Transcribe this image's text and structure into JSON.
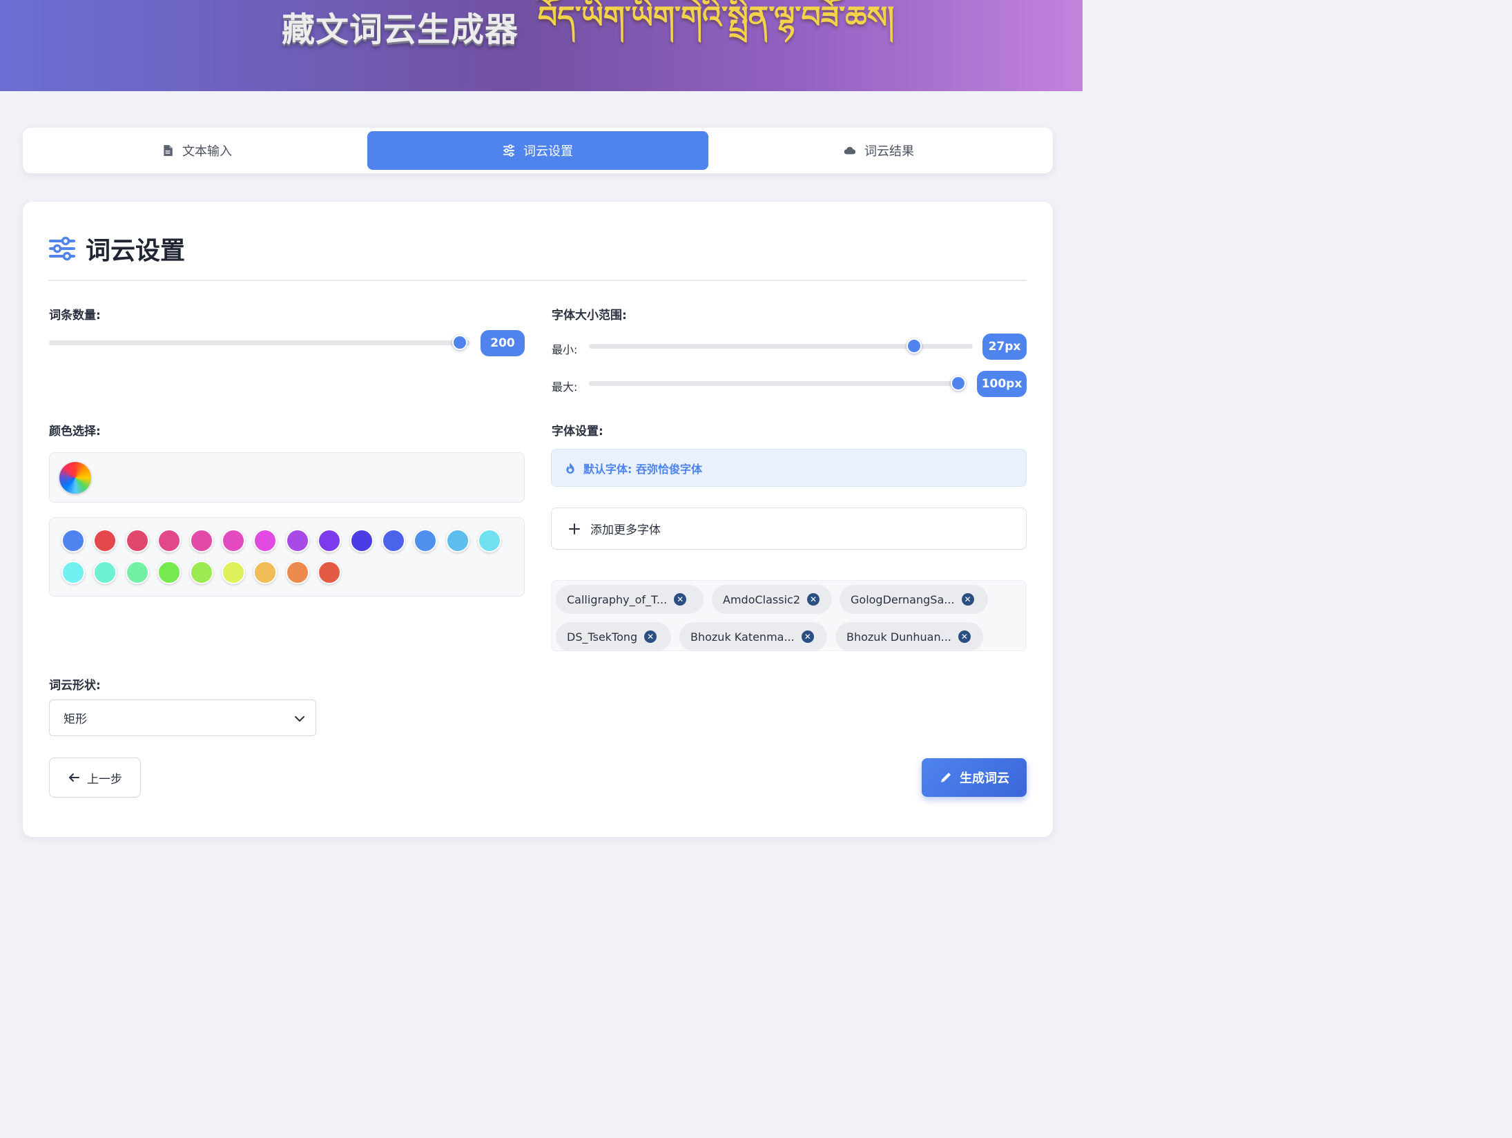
{
  "header": {
    "title_cn": "藏文词云生成器",
    "title_bo": "བོད་ཡིག་ཡིག་གེའི་སྤྲིན་ལྷ་བཟོ་ཆས།"
  },
  "tabs": [
    {
      "label": "文本输入",
      "icon": "file-icon",
      "active": false
    },
    {
      "label": "词云设置",
      "icon": "sliders-icon",
      "active": true
    },
    {
      "label": "词云结果",
      "icon": "cloud-icon",
      "active": false
    }
  ],
  "settings": {
    "title": "词云设置",
    "word_count": {
      "label": "词条数量:",
      "value": 200,
      "display": "200",
      "fraction": 0.96
    },
    "font_size": {
      "label": "字体大小范围:",
      "min": {
        "label": "最小:",
        "value": 27,
        "display": "27px",
        "fraction": 0.85
      },
      "max": {
        "label": "最大:",
        "value": 100,
        "display": "100px",
        "fraction": 0.96
      }
    },
    "color": {
      "label": "颜色选择:",
      "swatches": [
        "#4f84ee",
        "#e5484d",
        "#e0476a",
        "#e24889",
        "#e24aa8",
        "#e24ac0",
        "#e04ae0",
        "#a84ae6",
        "#7c3aed",
        "#4c3ce6",
        "#4a63ea",
        "#4f90ee",
        "#5cbdee",
        "#6ee0f0",
        "#72f0f2",
        "#6ef0d2",
        "#74f0a6",
        "#74ea4e",
        "#9cea52",
        "#def05a",
        "#f0bc56",
        "#ec8a4e",
        "#e45a44"
      ]
    },
    "font": {
      "label": "字体设置:",
      "default_text": "默认字体: 吞弥恰俊字体",
      "add_label": "添加更多字体",
      "fonts": [
        "Calligraphy_of_T...",
        "AmdoClassic2",
        "GologDernangSa...",
        "DS_TsekTong",
        "Bhozuk Katenma...",
        "Bhozuk Dunhuan..."
      ]
    },
    "shape": {
      "label": "词云形状:",
      "value": "矩形"
    }
  },
  "actions": {
    "prev_label": "上一步",
    "generate_label": "生成词云"
  },
  "colors": {
    "accent": "#4f84ee"
  }
}
